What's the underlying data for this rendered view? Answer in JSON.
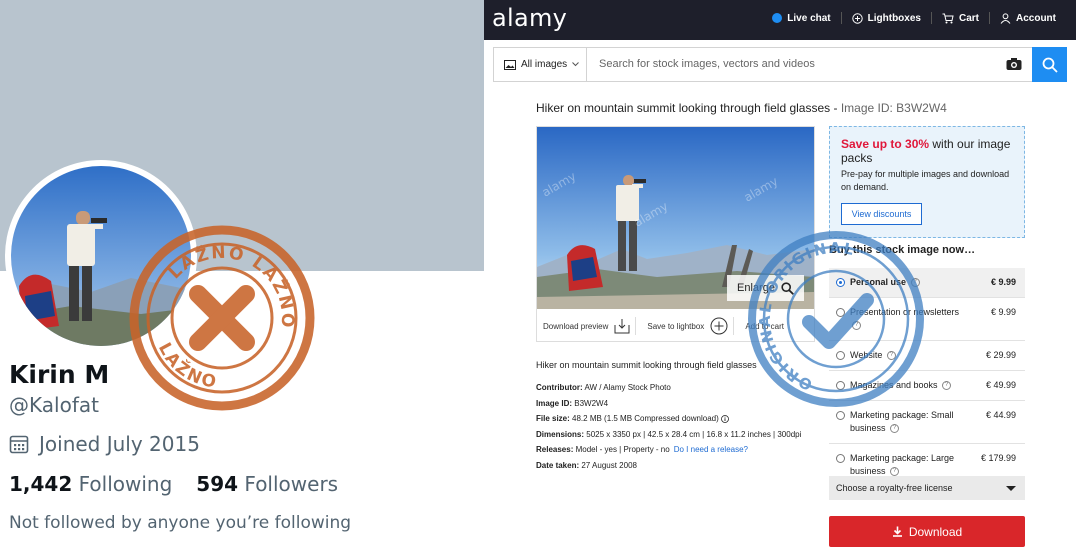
{
  "twitter": {
    "name": "Kirin M",
    "handle": "@Kalofat",
    "joined": "Joined July 2015",
    "following_count": "1,442",
    "following_label": "Following",
    "followers_count": "594",
    "followers_label": "Followers",
    "not_followed": "Not followed by anyone you’re following",
    "banner_color": "#b8c4ce"
  },
  "stamp_left": {
    "top_text": "LAŽNO LAŽNO",
    "bottom_text": "LAŽNO",
    "color": "#c8642a"
  },
  "stamp_right": {
    "text": "ORIGINAL ORIGINAL",
    "color": "#3f7fc2"
  },
  "alamy": {
    "logo": "alamy",
    "nav": {
      "live_chat": "Live chat",
      "lightboxes": "Lightboxes",
      "cart": "Cart",
      "account": "Account"
    },
    "search": {
      "filter": "All images",
      "placeholder": "Search for stock images, vectors and videos"
    },
    "title": "Hiker on mountain summit looking through field glasses -",
    "title_id": "Image ID: B3W2W4",
    "enlarge": "Enlarge",
    "download_preview": "Download preview",
    "save_to_lightbox": "Save to lightbox",
    "add_to_cart": "Add to cart",
    "caption": "Hiker on mountain summit looking through field glasses",
    "meta": {
      "contributor_label": "Contributor:",
      "contributor": "AW / Alamy Stock Photo",
      "image_id_label": "Image ID:",
      "image_id": "B3W2W4",
      "file_size_label": "File size:",
      "file_size": "48.2 MB (1.5 MB Compressed download)",
      "dimensions_label": "Dimensions:",
      "dimensions": "5025 x 3350 px | 42.5 x 28.4 cm | 16.8 x 11.2 inches | 300dpi",
      "releases_label": "Releases:",
      "releases": "Model - yes | Property - no",
      "release_link": "Do I need a release?",
      "date_label": "Date taken:",
      "date": "27 August 2008"
    },
    "promo": {
      "highlight": "Save up to 30%",
      "rest": " with our image packs",
      "body": "Pre-pay for multiple images and download on demand.",
      "button": "View discounts"
    },
    "buy_heading": "Buy this stock image now…",
    "options": [
      {
        "label": "Personal use",
        "price": "€ 9.99"
      },
      {
        "label": "Presentation or newsletters",
        "price": "€ 9.99"
      },
      {
        "label": "Website",
        "price": "€ 29.99"
      },
      {
        "label": "Magazines and books",
        "price": "€ 49.99"
      },
      {
        "label": "Marketing package: Small business",
        "price": "€ 44.99"
      },
      {
        "label": "Marketing package: Large business",
        "price": "€ 179.99"
      }
    ],
    "license_select": "Choose a royalty-free license",
    "download": "Download",
    "accent": "#1e8df2",
    "download_color": "#d9262a"
  }
}
